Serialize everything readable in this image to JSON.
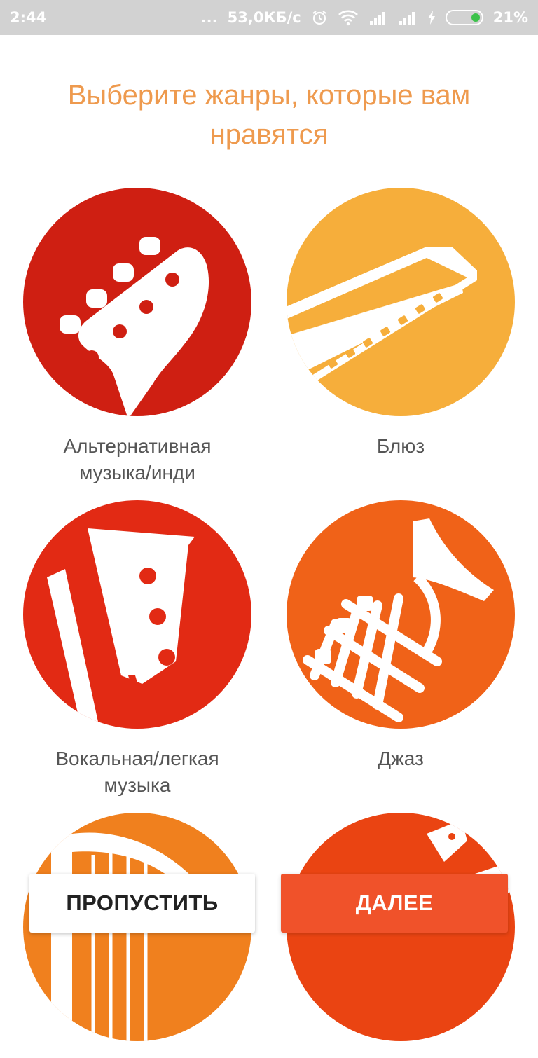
{
  "status_bar": {
    "time": "2:44",
    "dots": "...",
    "speed": "53,0КБ/с",
    "battery_percent": "21%"
  },
  "title": "Выберите жанры, которые вам нравятся",
  "genres": [
    {
      "label": "Альтернативная\nмузыка/инди",
      "icon": "guitar-headstock-icon",
      "color": "#cf1f12"
    },
    {
      "label": "Блюз",
      "icon": "harmonica-icon",
      "color": "#f6ae3b"
    },
    {
      "label": "Вокальная/легкая\nмузыка",
      "icon": "bass-headstock-icon",
      "color": "#e22a14"
    },
    {
      "label": "Джаз",
      "icon": "trumpet-icon",
      "color": "#f06218"
    },
    {
      "label": "",
      "icon": "harp-icon",
      "color": "#f0801e"
    },
    {
      "label": "",
      "icon": "electric-guitar-icon",
      "color": "#ea4412"
    }
  ],
  "buttons": {
    "skip": "ПРОПУСТИТЬ",
    "next": "ДАЛЕЕ"
  }
}
